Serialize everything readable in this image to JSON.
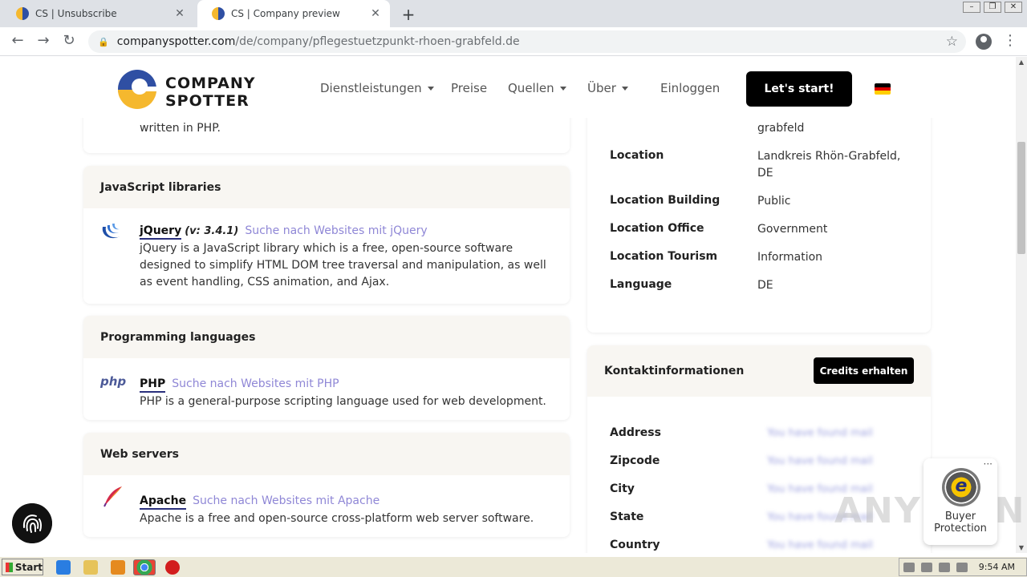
{
  "browser": {
    "tabs": [
      {
        "title": "CS | Unsubscribe",
        "active": false
      },
      {
        "title": "CS | Company preview",
        "active": true
      }
    ],
    "url_host": "companyspotter.com",
    "url_path": "/de/company/pflegestuetzpunkt-rhoen-grabfeld.de"
  },
  "header": {
    "logo_line1": "COMPANY",
    "logo_line2": "SPOTTER",
    "nav": [
      "Dienstleistungen",
      "Preise",
      "Quellen",
      "Über",
      "Einloggen"
    ],
    "cta": "Let's start!"
  },
  "tech": {
    "partial_desc": "written in PHP.",
    "sections": [
      {
        "heading": "JavaScript libraries",
        "name": "jQuery",
        "version": "(v: 3.4.1)",
        "link": "Suche nach Websites mit jQuery",
        "desc": "jQuery is a JavaScript library which is a free, open-source software designed to simplify HTML DOM tree traversal and manipulation, as well as event handling, CSS animation, and Ajax."
      },
      {
        "heading": "Programming languages",
        "name": "PHP",
        "link": "Suche nach Websites mit PHP",
        "desc": "PHP is a general-purpose scripting language used for web development."
      },
      {
        "heading": "Web servers",
        "name": "Apache",
        "link": "Suche nach Websites mit Apache",
        "desc": "Apache is a free and open-source cross-platform web server software."
      }
    ],
    "php_icon_text": "php"
  },
  "details": {
    "partial_value": "grabfeld",
    "rows": [
      {
        "label": "Location",
        "value": "Landkreis Rhön-Grabfeld, DE"
      },
      {
        "label": "Location Building",
        "value": "Public"
      },
      {
        "label": "Location Office",
        "value": "Government"
      },
      {
        "label": "Location Tourism",
        "value": "Information"
      },
      {
        "label": "Language",
        "value": "DE"
      }
    ]
  },
  "contact": {
    "heading": "Kontaktinformationen",
    "button": "Credits erhalten",
    "rows": [
      {
        "label": "Address",
        "value": "You have found mail"
      },
      {
        "label": "Zipcode",
        "value": "You have found mail"
      },
      {
        "label": "City",
        "value": "You have found mail"
      },
      {
        "label": "State",
        "value": "You have found mail"
      },
      {
        "label": "Country",
        "value": "You have found mail"
      }
    ]
  },
  "trusted_shops": {
    "seal_letter": "e",
    "line1": "Buyer",
    "line2": "Protection"
  },
  "watermark": "ANY RUN",
  "taskbar": {
    "start": "Start",
    "time": "9:54 AM"
  },
  "colors": {
    "brand_blue": "#2f4fa3",
    "brand_yellow": "#f5b82e",
    "link": "#8f87d6",
    "cta": "#000000"
  }
}
